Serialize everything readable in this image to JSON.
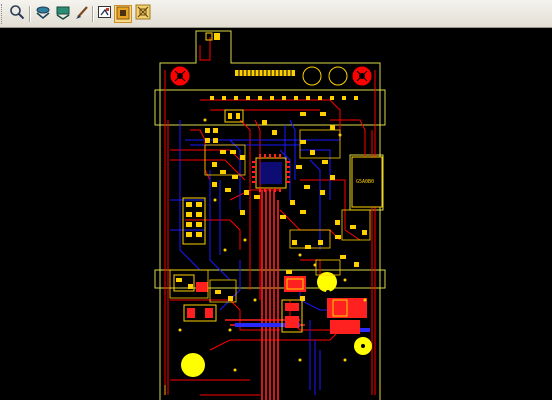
{
  "toolbar": {
    "buttons": [
      {
        "name": "zoom-icon",
        "tooltip": ""
      },
      {
        "name": "layer-view-1-icon",
        "tooltip": ""
      },
      {
        "name": "layer-view-2-icon",
        "tooltip": ""
      },
      {
        "name": "brush-icon",
        "tooltip": ""
      },
      {
        "name": "pcb-view-1-icon",
        "tooltip": ""
      },
      {
        "name": "pcb-view-2-icon",
        "tooltip": "",
        "active": true
      },
      {
        "name": "pcb-view-3-icon",
        "tooltip": ""
      }
    ]
  },
  "pcb": {
    "component_label": "G5A0B0",
    "colors": {
      "background": "#000000",
      "top_copper": "#ff0000",
      "bottom_copper": "#1a1aff",
      "silkscreen": "#ffff00",
      "outline": "#d9d94a"
    }
  }
}
